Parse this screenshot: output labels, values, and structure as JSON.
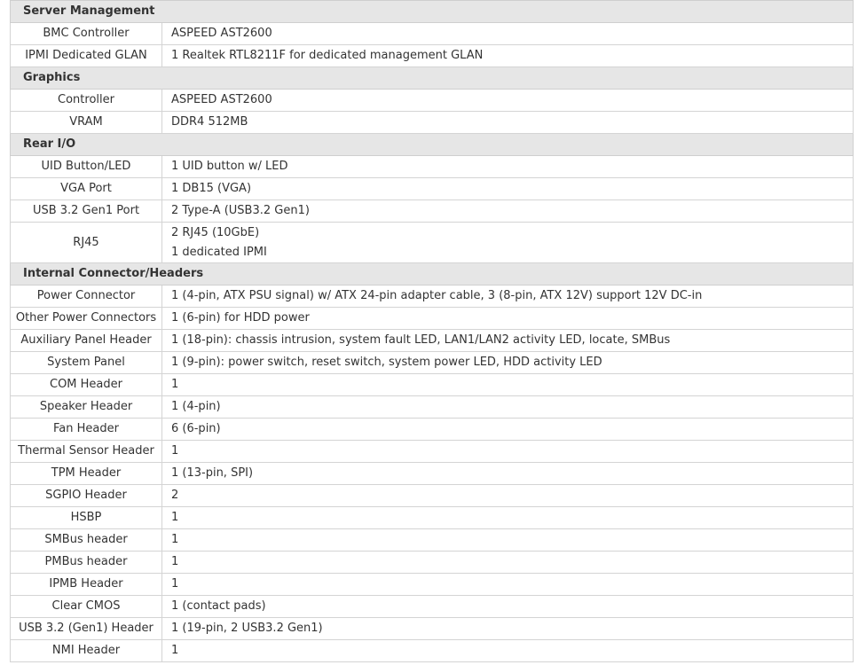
{
  "sections": [
    {
      "title": "Server Management",
      "rows": [
        {
          "label": "BMC Controller",
          "values": [
            "ASPEED AST2600"
          ]
        },
        {
          "label": "IPMI Dedicated GLAN",
          "values": [
            "1 Realtek RTL8211F for dedicated management GLAN"
          ]
        }
      ]
    },
    {
      "title": "Graphics",
      "rows": [
        {
          "label": "Controller",
          "values": [
            "ASPEED AST2600"
          ]
        },
        {
          "label": "VRAM",
          "values": [
            "DDR4 512MB"
          ]
        }
      ]
    },
    {
      "title": "Rear I/O",
      "rows": [
        {
          "label": "UID Button/LED",
          "values": [
            "1 UID button w/ LED"
          ]
        },
        {
          "label": "VGA Port",
          "values": [
            "1 DB15 (VGA)"
          ]
        },
        {
          "label": "USB 3.2 Gen1 Port",
          "values": [
            "2 Type-A (USB3.2 Gen1)"
          ]
        },
        {
          "label": "RJ45",
          "values": [
            "2 RJ45 (10GbE)",
            "1 dedicated IPMI"
          ]
        }
      ]
    },
    {
      "title": "Internal Connector/Headers",
      "rows": [
        {
          "label": "Power Connector",
          "values": [
            "1 (4-pin, ATX PSU signal) w/ ATX 24-pin adapter cable, 3 (8-pin, ATX 12V) support 12V DC-in"
          ]
        },
        {
          "label": "Other Power Connectors",
          "values": [
            "1 (6-pin) for HDD power"
          ]
        },
        {
          "label": "Auxiliary Panel Header",
          "values": [
            "1 (18-pin): chassis intrusion, system fault LED, LAN1/LAN2 activity LED, locate, SMBus"
          ]
        },
        {
          "label": "System Panel",
          "values": [
            "1 (9-pin): power switch, reset switch, system power LED, HDD activity LED"
          ]
        },
        {
          "label": "COM Header",
          "values": [
            "1"
          ]
        },
        {
          "label": "Speaker Header",
          "values": [
            "1 (4-pin)"
          ]
        },
        {
          "label": "Fan Header",
          "values": [
            "6 (6-pin)"
          ]
        },
        {
          "label": "Thermal Sensor Header",
          "values": [
            "1"
          ]
        },
        {
          "label": "TPM Header",
          "values": [
            "1 (13-pin, SPI)"
          ]
        },
        {
          "label": "SGPIO Header",
          "values": [
            "2"
          ]
        },
        {
          "label": "HSBP",
          "values": [
            "1"
          ]
        },
        {
          "label": "SMBus header",
          "values": [
            "1"
          ]
        },
        {
          "label": "PMBus header",
          "values": [
            "1"
          ]
        },
        {
          "label": "IPMB Header",
          "values": [
            "1"
          ]
        },
        {
          "label": "Clear CMOS",
          "values": [
            "1 (contact pads)"
          ]
        },
        {
          "label": "USB 3.2 (Gen1) Header",
          "values": [
            "1 (19-pin, 2 USB3.2 Gen1)"
          ]
        },
        {
          "label": "NMI Header",
          "values": [
            "1"
          ]
        }
      ]
    }
  ]
}
